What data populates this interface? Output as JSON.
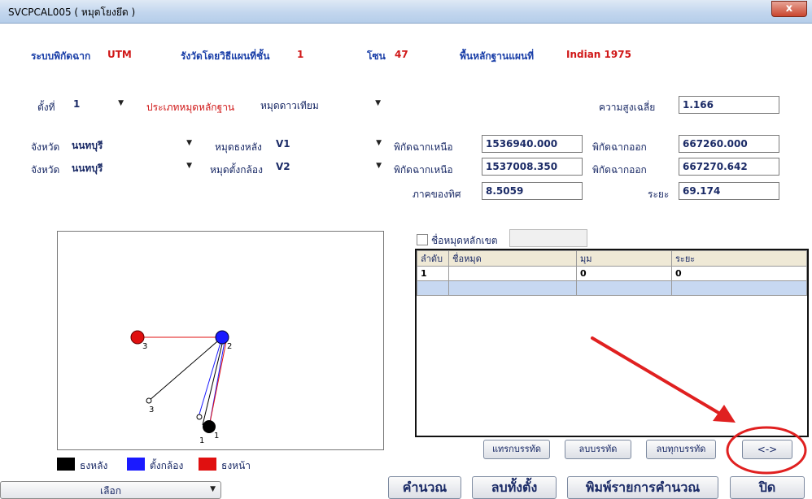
{
  "window": {
    "title": "SVCPCAL005 ( หมุดโยงยึด )",
    "close_glyph": "x"
  },
  "header": {
    "coord_label": "ระบบพิกัดฉาก",
    "coord_value": "UTM",
    "method_label": "รังวัดโดยวิธีแผนที่ชั้น",
    "method_value": "1",
    "zone_label": "โซน",
    "zone_value": "47",
    "datum_label": "พื้นหลักฐานแผนที่",
    "datum_value": "Indian 1975"
  },
  "setup": {
    "station_label": "ตั้งที่",
    "station_value": "1",
    "type_label": "ประเภทหมุดหลักฐาน",
    "type_value": "หมุดดาวเทียม",
    "avg_height_label": "ความสูงเฉลี่ย",
    "avg_height_value": "1.166"
  },
  "row1": {
    "province_label": "จังหวัด",
    "province_value": "นนทบุรี",
    "mark_label": "หมุดธงหลัง",
    "mark_value": "V1",
    "north_label": "พิกัดฉากเหนือ",
    "north_value": "1536940.000",
    "east_label": "พิกัดฉากออก",
    "east_value": "667260.000"
  },
  "row2": {
    "province_label": "จังหวัด",
    "province_value": "นนทบุรี",
    "mark_label": "หมุดตั้งกล้อง",
    "mark_value": "V2",
    "north_label": "พิกัดฉากเหนือ",
    "north_value": "1537008.350",
    "east_label": "พิกัดฉากออก",
    "east_value": "667270.642"
  },
  "row3": {
    "bearing_label": "ภาคของทิศ",
    "bearing_value": "8.5059",
    "distance_label": "ระยะ",
    "distance_value": "69.174"
  },
  "boundary": {
    "checkbox_label": "ชื่อหมุดหลักเขต",
    "input_value": ""
  },
  "grid": {
    "headers": [
      "ลำดับ",
      "ชื่อหมุด",
      "มุม",
      "ระยะ"
    ],
    "rows": [
      [
        "1",
        "",
        "0",
        "0"
      ]
    ]
  },
  "diagram": {
    "points": [
      {
        "label": "1",
        "color": "#000000"
      },
      {
        "label": "2",
        "color": "#1a1aff"
      },
      {
        "label": "3",
        "color": "#e01010"
      },
      {
        "label": "3",
        "color": "#ffffff"
      },
      {
        "label": "1",
        "color": "#ffffff"
      }
    ]
  },
  "legend": {
    "backsight": "ธงหลัง",
    "instrument": "ตั้งกล้อง",
    "foresight": "ธงหน้า"
  },
  "buttons": {
    "insert_row": "แทรกบรรทัด",
    "delete_row": "ลบบรรทัด",
    "delete_all_rows": "ลบทุกบรรทัด",
    "swap": "<->",
    "calculate": "คำนวณ",
    "clear_all": "ลบทั้งตั้ง",
    "print": "พิมพ์รายการคำนวณ",
    "close": "ปิด"
  },
  "select_dropdown": {
    "value": "เลือก"
  },
  "colors": {
    "backsight": "#000000",
    "instrument": "#1a1aff",
    "foresight": "#e01010",
    "annotation": "#e02020"
  }
}
